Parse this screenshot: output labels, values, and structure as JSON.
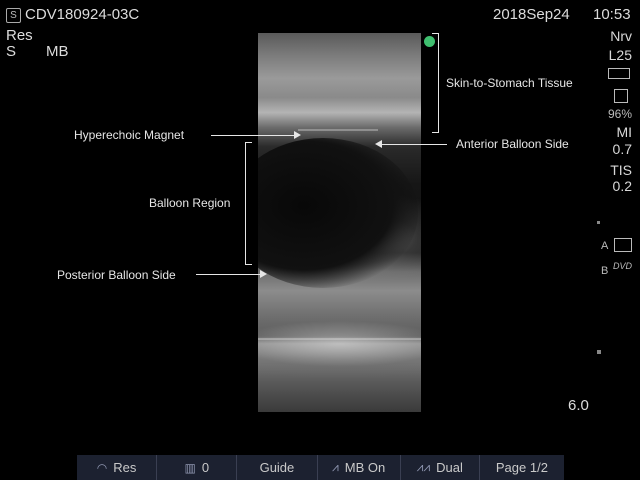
{
  "header": {
    "exam_id": "CDV180924-03C",
    "date": "2018Sep24",
    "time": "10:53",
    "res": "Res",
    "mode_s": "S",
    "mode_mb": "MB"
  },
  "side_panel": {
    "nrv": "Nrv",
    "probe": "L25",
    "battery": "96%",
    "mi_label": "MI",
    "mi_value": "0.7",
    "tis_label": "TIS",
    "tis_value": "0.2",
    "printer_a": "A",
    "printer_b": "B",
    "dvd": "DVD"
  },
  "depth": "6.0",
  "annotations": {
    "skin_to_stomach": "Skin-to-Stomach Tissue",
    "hyperechoic_magnet": "Hyperechoic Magnet",
    "anterior_balloon": "Anterior Balloon Side",
    "balloon_region": "Balloon Region",
    "posterior_balloon": "Posterior Balloon Side"
  },
  "toolbar": {
    "res": "Res",
    "zero": "0",
    "guide": "Guide",
    "mb_on": "MB On",
    "dual": "Dual",
    "page": "Page 1/2"
  },
  "colors": {
    "orientation_marker": "#3fbf6f",
    "toolbar_bg": "#1c2130"
  }
}
